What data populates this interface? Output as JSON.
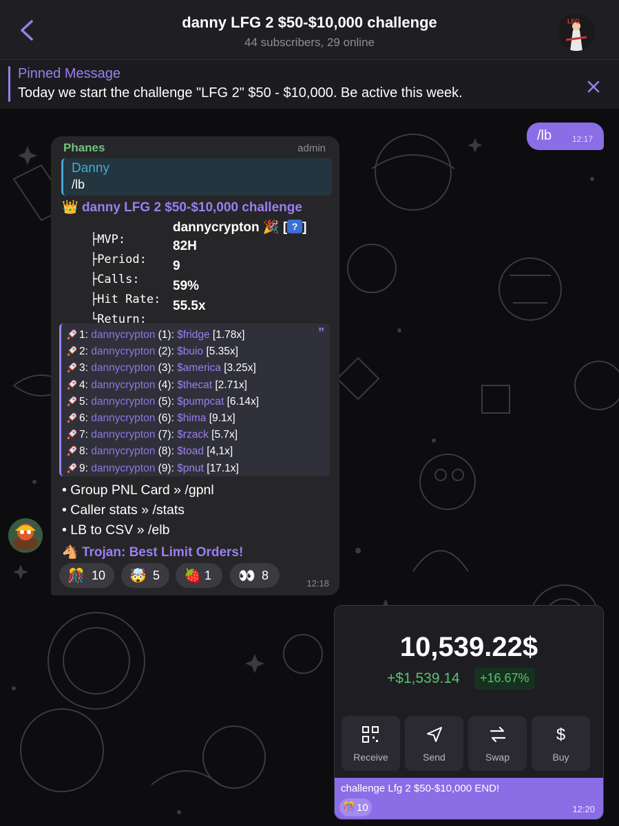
{
  "header": {
    "title": "danny LFG 2 $50-$10,000 challenge",
    "subtitle": "44 subscribers, 29 online",
    "avatar_label": "LFG"
  },
  "pinned": {
    "title": "Pinned Message",
    "text": "Today we start the challenge \"LFG 2\" $50 - $10,000. Be active this week."
  },
  "outgoing": {
    "text": "/lb",
    "time": "12:17"
  },
  "bot_message": {
    "sender": "Phanes",
    "role": "admin",
    "reply": {
      "name": "Danny",
      "text": "/lb"
    },
    "lb_title": "danny LFG 2 $50-$10,000 challenge",
    "stats": [
      {
        "label": "├MVP:",
        "value": "dannycrypton 🎉 [",
        "suffix": "]"
      },
      {
        "label": "├Period:",
        "value": "82H"
      },
      {
        "label": "├Calls:",
        "value": "9"
      },
      {
        "label": "├Hit Rate:",
        "value": "59%"
      },
      {
        "label": "└Return:",
        "value": "55.5x"
      }
    ],
    "leaderboard": [
      {
        "rank": "1:",
        "caller": "dannycrypton",
        "count": "(1):",
        "token": "$fridge",
        "mult": "[1.78x]"
      },
      {
        "rank": "2:",
        "caller": "dannycrypton",
        "count": "(2):",
        "token": "$buio",
        "mult": "[5.35x]"
      },
      {
        "rank": "3:",
        "caller": "dannycrypton",
        "count": "(3):",
        "token": "$america",
        "mult": "[3.25x]"
      },
      {
        "rank": "4:",
        "caller": "dannycrypton",
        "count": "(4):",
        "token": "$thecat",
        "mult": "[2.71x]"
      },
      {
        "rank": "5:",
        "caller": "dannycrypton",
        "count": "(5):",
        "token": "$pumpcat",
        "mult": "[6.14x]"
      },
      {
        "rank": "6:",
        "caller": "dannycrypton",
        "count": "(6):",
        "token": "$hima",
        "mult": "[9.1x]"
      },
      {
        "rank": "7:",
        "caller": "dannycrypton",
        "count": "(7):",
        "token": "$rzack",
        "mult": "[5.7x]"
      },
      {
        "rank": "8:",
        "caller": "dannycrypton",
        "count": "(8):",
        "token": "$toad",
        "mult": "[4,1x]"
      },
      {
        "rank": "9:",
        "caller": "dannycrypton",
        "count": "(9):",
        "token": "$pnut",
        "mult": "[17.1x]"
      }
    ],
    "commands": [
      "• Group PNL Card » /gpnl",
      "• Caller stats » /stats",
      "• LB to CSV » /elb"
    ],
    "trojan": "Trojan: Best Limit Orders!",
    "reactions": [
      {
        "emoji": "🎊",
        "count": "10"
      },
      {
        "emoji": "🤯",
        "count": "5"
      },
      {
        "emoji": "🍓",
        "count": "1"
      },
      {
        "emoji": "👀",
        "count": "8"
      }
    ],
    "time": "12:18"
  },
  "wallet_message": {
    "balance": "10,539.22$",
    "gain": "+$1,539.14",
    "gain_pct": "+16.67%",
    "actions": [
      {
        "label": "Receive",
        "icon": "qr-icon"
      },
      {
        "label": "Send",
        "icon": "send-icon"
      },
      {
        "label": "Swap",
        "icon": "swap-icon"
      },
      {
        "label": "Buy",
        "icon": "dollar-icon"
      }
    ],
    "caption": "challenge Lfg 2 $50-$10,000 END!",
    "reaction": {
      "emoji": "🎊",
      "count": "10"
    },
    "time": "12:20"
  },
  "colors": {
    "accent": "#9b7ff0",
    "outgoing_bubble": "#8b6de6",
    "sender_name": "#71c27c",
    "gain_green": "#58c26f"
  }
}
